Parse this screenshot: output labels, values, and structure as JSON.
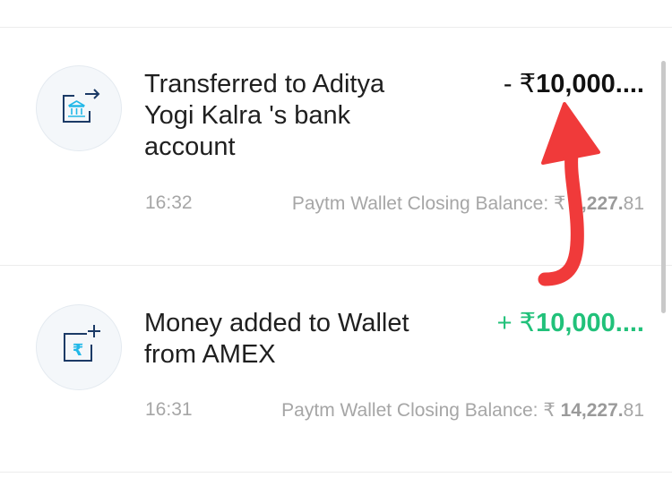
{
  "transactions": [
    {
      "title": "Transferred to Aditya Yogi Kalra 's bank account",
      "sign": "- ₹",
      "amount": "10,000....",
      "type": "debit",
      "time": "16:32",
      "balance_label": "Paytm Wallet Closing Balance: ₹",
      "balance_main": "4,227.",
      "balance_decimal": "81",
      "icon": "bank-transfer-icon"
    },
    {
      "title": "Money added to Wallet from AMEX",
      "sign": "+ ₹",
      "amount": "10,000....",
      "type": "credit",
      "time": "16:31",
      "balance_label": "Paytm Wallet Closing Balance: ₹",
      "balance_main": "14,227.",
      "balance_decimal": "81",
      "icon": "wallet-add-money-icon"
    }
  ],
  "colors": {
    "credit": "#21c17a",
    "debit": "#111111",
    "icon_blue": "#1b3a66",
    "icon_accent": "#22b8e8",
    "annotation_arrow": "#f03a3a"
  }
}
